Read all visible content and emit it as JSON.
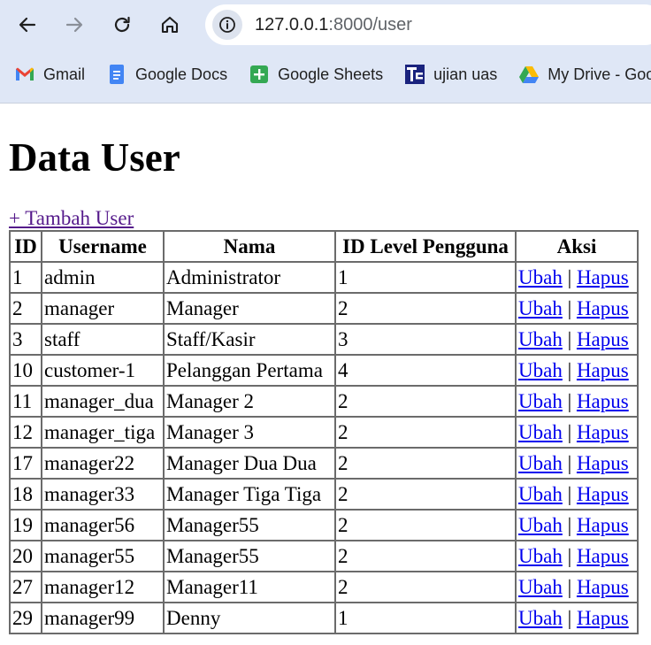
{
  "browser": {
    "url_host": "127.0.0.1",
    "url_rest": ":8000/user",
    "bookmarks": [
      {
        "label": "Gmail",
        "icon": "gmail-icon"
      },
      {
        "label": "Google Docs",
        "icon": "google-docs-icon"
      },
      {
        "label": "Google Sheets",
        "icon": "google-sheets-icon"
      },
      {
        "label": "ujian uas",
        "icon": "ujian-uas-icon"
      },
      {
        "label": "My Drive - Goog",
        "icon": "google-drive-icon"
      }
    ]
  },
  "page": {
    "title": "Data User",
    "add_link": "+ Tambah User"
  },
  "table": {
    "headers": [
      "ID",
      "Username",
      "Nama",
      "ID Level Pengguna",
      "Aksi"
    ],
    "action_edit": "Ubah",
    "action_sep": "|",
    "action_delete": "Hapus",
    "rows": [
      {
        "id": "1",
        "username": "admin",
        "nama": "Administrator",
        "level": "1"
      },
      {
        "id": "2",
        "username": "manager",
        "nama": "Manager",
        "level": "2"
      },
      {
        "id": "3",
        "username": "staff",
        "nama": "Staff/Kasir",
        "level": "3"
      },
      {
        "id": "10",
        "username": "customer-1",
        "nama": "Pelanggan Pertama",
        "level": "4"
      },
      {
        "id": "11",
        "username": "manager_dua",
        "nama": "Manager 2",
        "level": "2"
      },
      {
        "id": "12",
        "username": "manager_tiga",
        "nama": "Manager 3",
        "level": "2"
      },
      {
        "id": "17",
        "username": "manager22",
        "nama": "Manager Dua Dua",
        "level": "2"
      },
      {
        "id": "18",
        "username": "manager33",
        "nama": "Manager Tiga Tiga",
        "level": "2"
      },
      {
        "id": "19",
        "username": "manager56",
        "nama": "Manager55",
        "level": "2"
      },
      {
        "id": "20",
        "username": "manager55",
        "nama": "Manager55",
        "level": "2"
      },
      {
        "id": "27",
        "username": "manager12",
        "nama": "Manager11",
        "level": "2"
      },
      {
        "id": "29",
        "username": "manager99",
        "nama": "Denny",
        "level": "1"
      }
    ]
  }
}
